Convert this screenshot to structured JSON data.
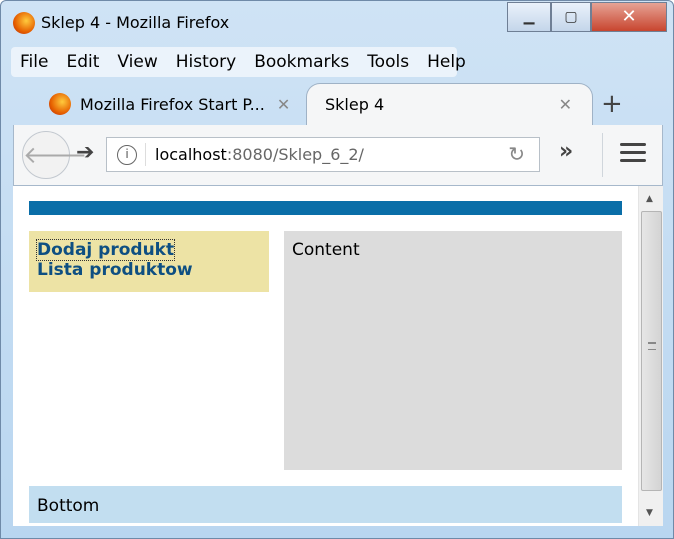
{
  "window": {
    "title": "Sklep 4 - Mozilla Firefox"
  },
  "menu": [
    "File",
    "Edit",
    "View",
    "History",
    "Bookmarks",
    "Tools",
    "Help"
  ],
  "tabs": [
    {
      "label": "Mozilla Firefox Start P...",
      "active": false
    },
    {
      "label": "Sklep 4",
      "active": true
    }
  ],
  "url": {
    "host": "localhost",
    "rest": ":8080/Sklep_6_2/"
  },
  "page": {
    "header_color": "#0a6ea8",
    "links": [
      "Dodaj produkt",
      "Lista produktow"
    ],
    "content": "Content",
    "bottom": "Bottom"
  },
  "colors": {
    "sidebar": "#ede3a5",
    "content": "#dcdcdc",
    "bottom": "#c2def0"
  }
}
